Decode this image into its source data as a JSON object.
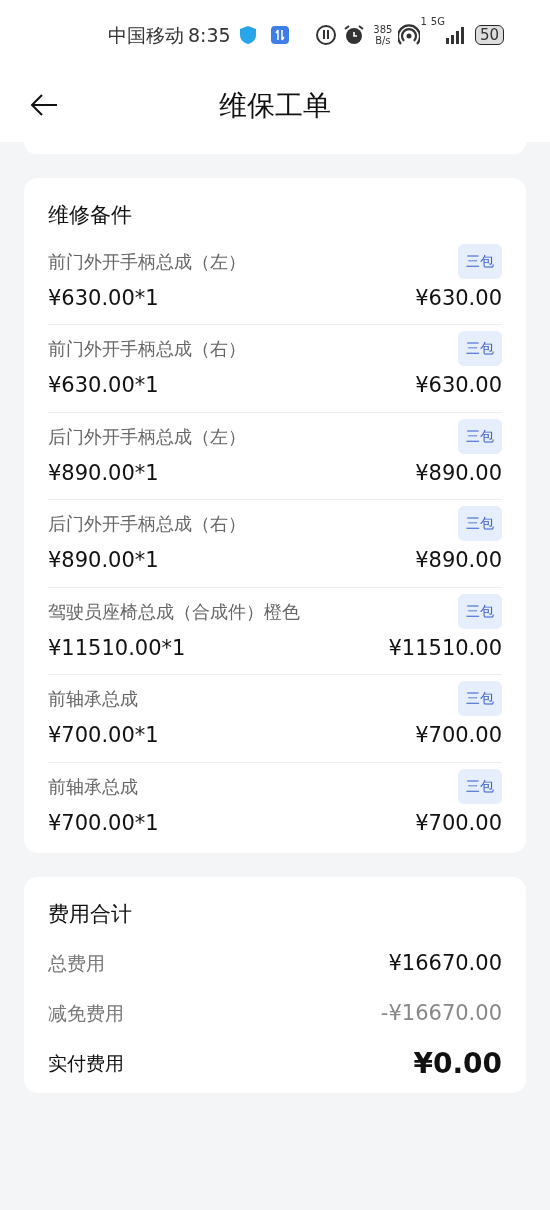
{
  "status_bar": {
    "carrier": "中国移动",
    "time": "8:35",
    "speed_value": "385",
    "speed_unit": "B/s",
    "sim": "1",
    "network": "5G",
    "battery": "50"
  },
  "header": {
    "title": "维保工单"
  },
  "parts": {
    "title": "维修备件",
    "items": [
      {
        "name": "前门外开手柄总成（左）",
        "badge": "三包",
        "unit_price": "¥630.00*1",
        "total": "¥630.00"
      },
      {
        "name": "前门外开手柄总成（右）",
        "badge": "三包",
        "unit_price": "¥630.00*1",
        "total": "¥630.00"
      },
      {
        "name": "后门外开手柄总成（左）",
        "badge": "三包",
        "unit_price": "¥890.00*1",
        "total": "¥890.00"
      },
      {
        "name": "后门外开手柄总成（右）",
        "badge": "三包",
        "unit_price": "¥890.00*1",
        "total": "¥890.00"
      },
      {
        "name": "驾驶员座椅总成（合成件）橙色",
        "badge": "三包",
        "unit_price": "¥11510.00*1",
        "total": "¥11510.00"
      },
      {
        "name": "前轴承总成",
        "badge": "三包",
        "unit_price": "¥700.00*1",
        "total": "¥700.00"
      },
      {
        "name": "前轴承总成",
        "badge": "三包",
        "unit_price": "¥700.00*1",
        "total": "¥700.00"
      }
    ]
  },
  "costs": {
    "title": "费用合计",
    "rows": [
      {
        "kind": "normal",
        "label": "总费用",
        "value": "¥16670.00"
      },
      {
        "kind": "discount",
        "label": "减免费用",
        "value": "-¥16670.00"
      },
      {
        "kind": "final",
        "label": "实付费用",
        "value": "¥0.00"
      }
    ]
  }
}
